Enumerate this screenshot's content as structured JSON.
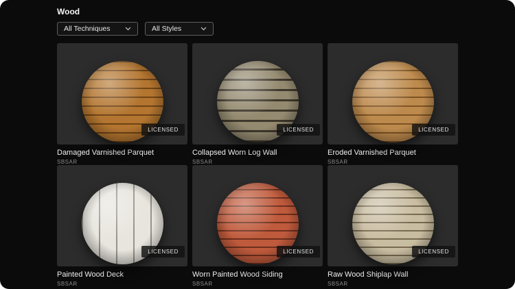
{
  "page": {
    "title": "Wood"
  },
  "filters": {
    "techniques": {
      "value": "All Techniques"
    },
    "styles": {
      "value": "All Styles"
    }
  },
  "badge_label": "LICENSED",
  "cards": [
    {
      "title": "Damaged Varnished Parquet",
      "format": "SBSAR",
      "sphere": {
        "base": "#b3752f",
        "stripe": "#6e4316",
        "direction": "horizontal",
        "line": 2,
        "period": 13
      }
    },
    {
      "title": "Collapsed Worn Log Wall",
      "format": "SBSAR",
      "sphere": {
        "base": "#948a70",
        "stripe": "#3e372b",
        "direction": "horizontal",
        "line": 3,
        "period": 15
      }
    },
    {
      "title": "Eroded Varnished Parquet",
      "format": "SBSAR",
      "sphere": {
        "base": "#bd8a4d",
        "stripe": "#7c5222",
        "direction": "horizontal",
        "line": 2,
        "period": 13
      }
    },
    {
      "title": "Painted Wood Deck",
      "format": "SBSAR",
      "sphere": {
        "base": "#e8e5de",
        "stripe": "#97928a",
        "direction": "vertical",
        "line": 2,
        "period": 25
      }
    },
    {
      "title": "Worn Painted Wood Siding",
      "format": "SBSAR",
      "sphere": {
        "base": "#bf5a3c",
        "stripe": "#6d2f1d",
        "direction": "horizontal",
        "line": 2,
        "period": 12
      }
    },
    {
      "title": "Raw Wood Shiplap Wall",
      "format": "SBSAR",
      "sphere": {
        "base": "#c9bda1",
        "stripe": "#76694f",
        "direction": "horizontal",
        "line": 2,
        "period": 12
      }
    }
  ]
}
